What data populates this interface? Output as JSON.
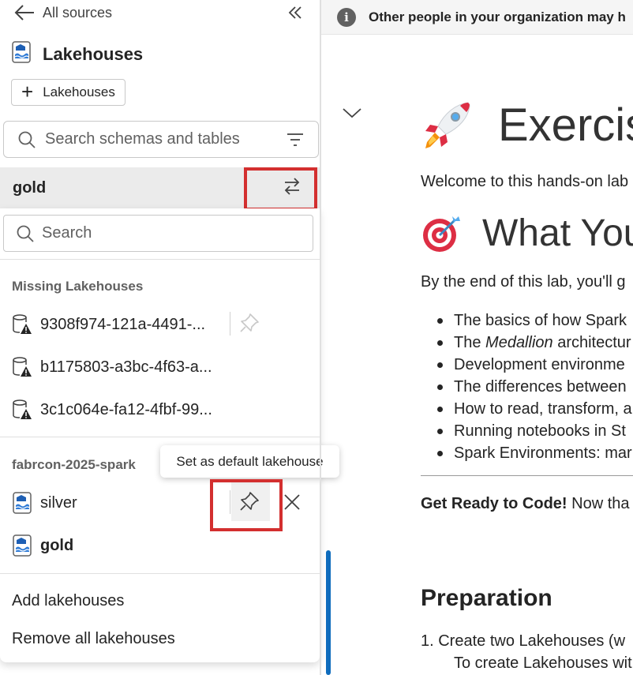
{
  "nav": {
    "back_label": "All sources"
  },
  "panel": {
    "title": "Lakehouses",
    "add_button_label": "Lakehouses",
    "search_placeholder": "Search schemas and tables"
  },
  "selected_lakehouse": "gold",
  "dropdown": {
    "search_placeholder": "Search",
    "missing_header": "Missing Lakehouses",
    "missing_items": [
      "9308f974-121a-4491-...",
      "b1175803-a3bc-4f63-a...",
      "3c1c064e-fa12-4fbf-99..."
    ],
    "workspace_header": "fabrcon-2025-spark",
    "workspace_items": [
      "silver",
      "gold"
    ],
    "tooltip": "Set as default lakehouse",
    "add_label": "Add lakehouses",
    "remove_label": "Remove all lakehouses"
  },
  "banner": {
    "text": "Other people in your organization may h"
  },
  "notebook": {
    "h1": "Exercis",
    "intro": "Welcome to this hands-on lab",
    "h2": "What You",
    "by_end": "By the end of this lab, you'll g",
    "bullets": [
      "The basics of how Spark",
      "The Medallion architectur",
      "Development environme",
      "The differences between",
      "How to read, transform, a",
      "Running notebooks in St",
      "Spark Environments: mar"
    ],
    "get_ready_bold": "Get Ready to Code!",
    "get_ready_rest": " Now tha",
    "prep_heading": "Preparation",
    "step1_line1": "1. Create two Lakehouses (w",
    "step1_line2": "To create Lakehouses wit"
  },
  "colors": {
    "accent": "#0f6cbd",
    "highlight_box": "#d32f2f",
    "selected_row": "#ebebeb"
  }
}
